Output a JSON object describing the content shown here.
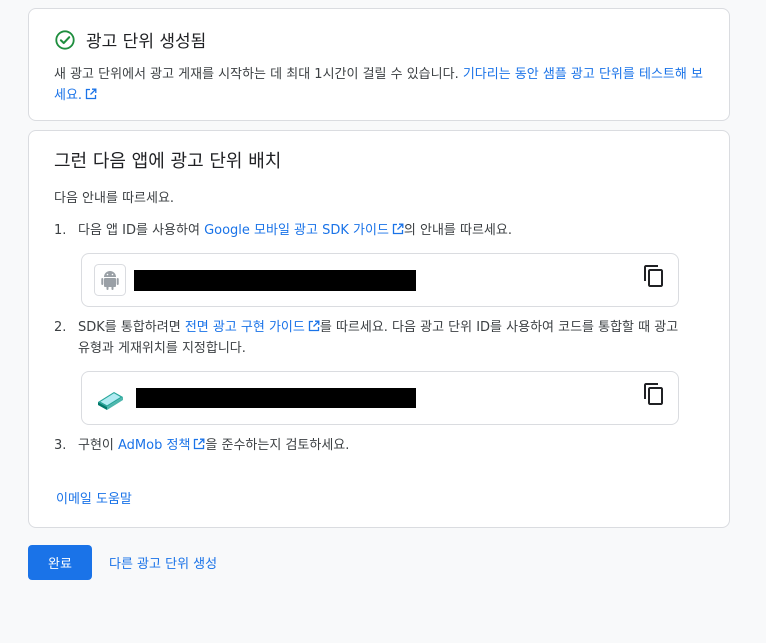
{
  "success": {
    "title": "광고 단위 생성됨",
    "message": "새 광고 단위에서 광고 게재를 시작하는 데 최대 1시간이 걸릴 수 있습니다. ",
    "test_link": "기다리는 동안 샘플 광고 단위를 테스트해 보세요."
  },
  "placement": {
    "title": "그런 다음 앱에 광고 단위 배치",
    "intro": "다음 안내를 따르세요.",
    "step1": {
      "num": "1.",
      "before": "다음 앱 ID를 사용하여 ",
      "link": "Google 모바일 광고 SDK 가이드",
      "after": "의 안내를 따르세요."
    },
    "step2": {
      "num": "2.",
      "before": "SDK를 통합하려면 ",
      "link": "전면 광고 구현 가이드",
      "after": "를 따르세요. 다음 광고 단위 ID를 사용하여 코드를 통합할 때 광고 유형과 게재위치를 지정합니다."
    },
    "step3": {
      "num": "3.",
      "before": "구현이 ",
      "link": "AdMob 정책",
      "after": "을 준수하는지 검토하세요."
    },
    "help_link": "이메일 도움말"
  },
  "actions": {
    "done": "완료",
    "create_another": "다른 광고 단위 생성"
  },
  "colors": {
    "accent": "#1a73e8",
    "success": "#1e8e3e"
  },
  "icons": [
    "check-circle-icon",
    "external-link-icon",
    "android-icon",
    "ad-unit-icon",
    "copy-icon"
  ]
}
